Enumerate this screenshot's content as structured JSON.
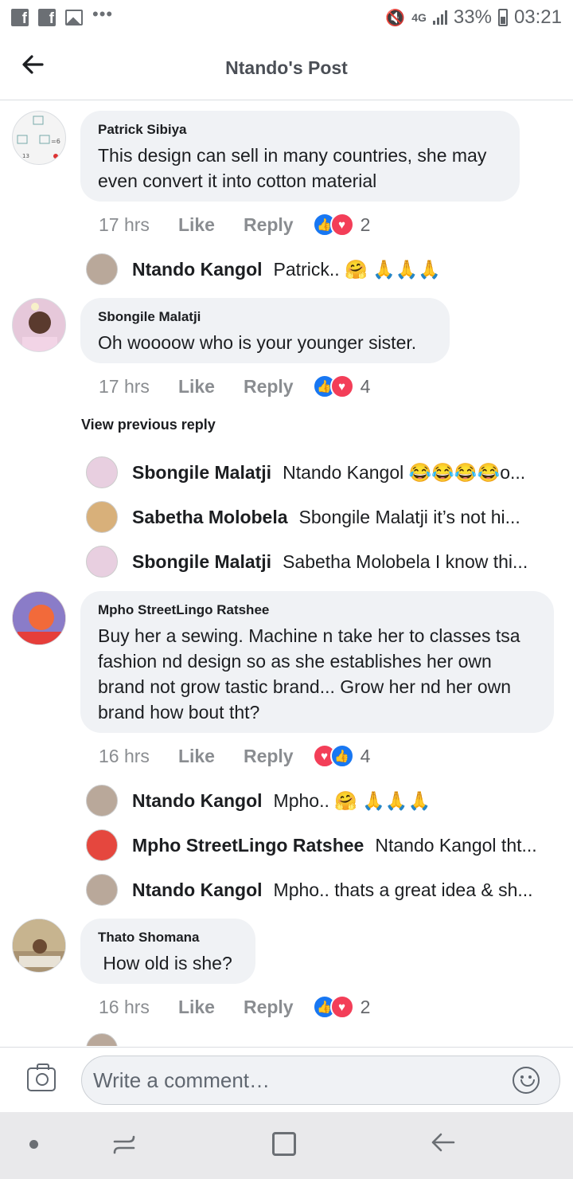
{
  "status_bar": {
    "signal": "4G",
    "battery": "33%",
    "time": "03:21",
    "icons": [
      "facebook-icon",
      "facebook-icon",
      "image-icon",
      "more-dots-icon",
      "mute-icon",
      "signal-icon",
      "battery-icon"
    ]
  },
  "header": {
    "title": "Ntando's Post",
    "back_icon": "back-arrow-icon"
  },
  "comments": [
    {
      "name": "Patrick Sibiya",
      "text_lines": [
        "This design can sell in many countries, she may",
        "even convert it into cotton material"
      ],
      "time": "17 hrs",
      "like": "Like",
      "reply": "Reply",
      "reactions": [
        "like",
        "love"
      ],
      "reaction_count": "2",
      "replies": [
        {
          "name": "Ntando Kangol",
          "text": "Patrick.. 🤗 🙏🙏🙏"
        }
      ]
    },
    {
      "name": "Sbongile Malatji",
      "text_lines": [
        "Oh woooow who is your younger sister."
      ],
      "time": "17 hrs",
      "like": "Like",
      "reply": "Reply",
      "reactions": [
        "like",
        "love"
      ],
      "reaction_count": "4",
      "view_previous": "View previous reply",
      "replies": [
        {
          "name": "Sbongile Malatji",
          "text": "Ntando Kangol 😂😂😂😂o..."
        },
        {
          "name": "Sabetha Molobela",
          "text": "Sbongile Malatji  it’s not hi..."
        },
        {
          "name": "Sbongile Malatji",
          "text": "Sabetha Molobela I know thi..."
        }
      ]
    },
    {
      "name": "Mpho StreetLingo Ratshee",
      "text_lines": [
        "Buy her a sewing. Machine n take her to classes tsa",
        "fashion nd design so as she establishes her own",
        "brand not grow tastic brand... Grow her nd her own",
        "brand how bout tht?"
      ],
      "time": "16 hrs",
      "like": "Like",
      "reply": "Reply",
      "reactions": [
        "love",
        "like"
      ],
      "reaction_count": "4",
      "replies": [
        {
          "name": "Ntando Kangol",
          "text": "Mpho.. 🤗 🙏🙏🙏"
        },
        {
          "name": "Mpho StreetLingo Ratshee",
          "text": "Ntando Kangol tht..."
        },
        {
          "name": "Ntando Kangol",
          "text": "Mpho.. thats a great idea & sh..."
        }
      ]
    },
    {
      "name": "Thato Shomana",
      "text_lines": [
        " How old is she?"
      ],
      "time": "16 hrs",
      "like": "Like",
      "reply": "Reply",
      "reactions": [
        "like",
        "love"
      ],
      "reaction_count": "2"
    }
  ],
  "composer": {
    "placeholder": "Write a comment…",
    "camera_icon": "camera-icon",
    "emoji_icon": "emoji-icon"
  },
  "nav_bar": {
    "icons": [
      "nav-dot-icon",
      "recent-apps-icon",
      "home-icon",
      "back-icon"
    ]
  }
}
